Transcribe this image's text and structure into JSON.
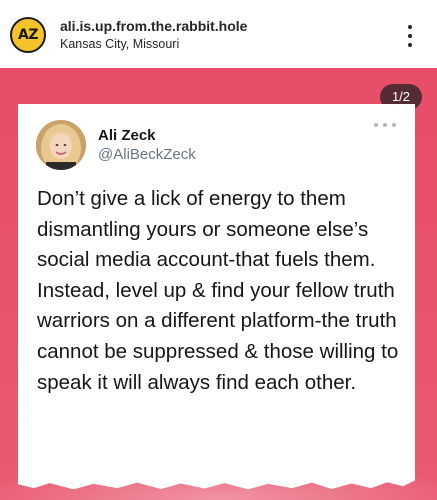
{
  "post": {
    "avatar_text": "AZ",
    "username": "ali.is.up.from.the.rabbit.hole",
    "location": "Kansas City, Missouri"
  },
  "media": {
    "page_indicator": "1/2",
    "background_color": "#e8506a"
  },
  "tweet": {
    "author_name": "Ali Zeck",
    "author_handle": "@AliBeckZeck",
    "text": "Don’t give a lick of energy to them dismantling yours or someone else’s social media account-that fuels them. Instead, level up & find your fellow truth warriors on a different platform-the truth cannot be suppressed & those willing to speak it will always find each other."
  },
  "icons": {
    "more_options": "more-vertical-icon",
    "tweet_more": "more-horizontal-icon"
  }
}
